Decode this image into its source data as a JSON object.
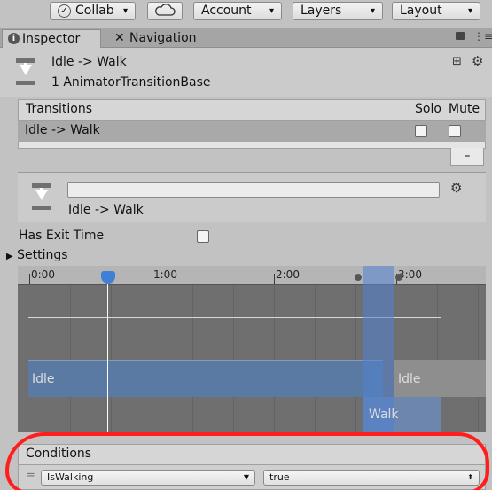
{
  "toolbar": {
    "collab_label": "Collab",
    "account_label": "Account",
    "layers_label": "Layers",
    "layout_label": "Layout",
    "caret": "▾"
  },
  "tabs": [
    {
      "label": "Inspector",
      "icon": "info-icon"
    },
    {
      "label": "Navigation",
      "icon": "navigation-icon"
    }
  ],
  "header": {
    "title": "Idle -> Walk",
    "subtitle": "1 AnimatorTransitionBase"
  },
  "transitions": {
    "header_label": "Transitions",
    "solo_label": "Solo",
    "mute_label": "Mute",
    "rows": [
      {
        "name": "Idle -> Walk",
        "solo": false,
        "mute": false
      }
    ],
    "remove_label": "–"
  },
  "detail": {
    "name_value": "",
    "label": "Idle -> Walk"
  },
  "has_exit_time": {
    "label": "Has Exit Time",
    "checked": false
  },
  "settings": {
    "label": "Settings",
    "arrow": "▶"
  },
  "timeline": {
    "ticks": [
      "0:00",
      "1:00",
      "2:00",
      "3:00"
    ],
    "tracks": {
      "source": "Idle",
      "destination_right": "Idle",
      "target": "Walk"
    }
  },
  "conditions": {
    "header_label": "Conditions",
    "parameter": "IsWalking",
    "value": "true",
    "handle": "="
  },
  "colors": {
    "highlight_red": "#ff1e1e",
    "selection_blue": "#3f7fd4"
  }
}
